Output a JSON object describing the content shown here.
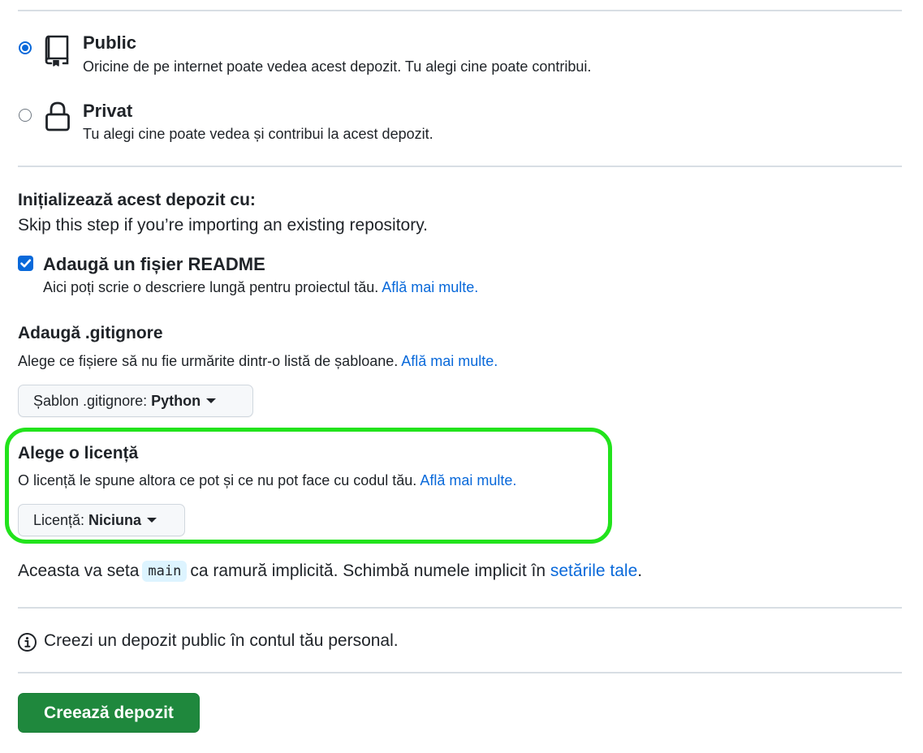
{
  "visibility": {
    "public": {
      "title": "Public",
      "description": "Oricine de pe internet poate vedea acest depozit. Tu alegi cine poate contribui.",
      "icon": "repo-icon",
      "selected": true
    },
    "private": {
      "title": "Privat",
      "description": "Tu alegi cine poate vedea și contribui la acest depozit.",
      "icon": "lock-icon",
      "selected": false
    }
  },
  "init": {
    "heading": "Inițializează acest depozit cu:",
    "subtitle": "Skip this step if you’re importing an existing repository.",
    "readme": {
      "label": "Adaugă un fișier README",
      "description": "Aici poți scrie o descriere lungă pentru proiectul tău.",
      "link": "Află mai multe.",
      "checked": true
    }
  },
  "gitignore": {
    "heading": "Adaugă .gitignore",
    "description": "Alege ce fișiere să nu fie urmărite dintr-o listă de șabloane.",
    "link": "Află mai multe.",
    "button_prefix": "Șablon .gitignore:",
    "button_value": "Python"
  },
  "license": {
    "heading": "Alege o licență",
    "description": "O licență le spune altora ce pot și ce nu pot face cu codul tău.",
    "link": "Află mai multe.",
    "button_prefix": "Licență:",
    "button_value": "Niciuna"
  },
  "branch": {
    "before": "Aceasta va seta",
    "branch_name": "main",
    "after": "ca ramură implicită. Schimbă numele implicit în",
    "link": "setările tale",
    "end": "."
  },
  "notice": {
    "icon": "info-icon",
    "text": "Creezi un depozit public în contul tău personal."
  },
  "create_button": "Creează depozit",
  "colors": {
    "accent": "#0969da",
    "primary_button": "#1f883d",
    "highlight": "#22e31c",
    "code_bg": "#ddf4ff"
  }
}
